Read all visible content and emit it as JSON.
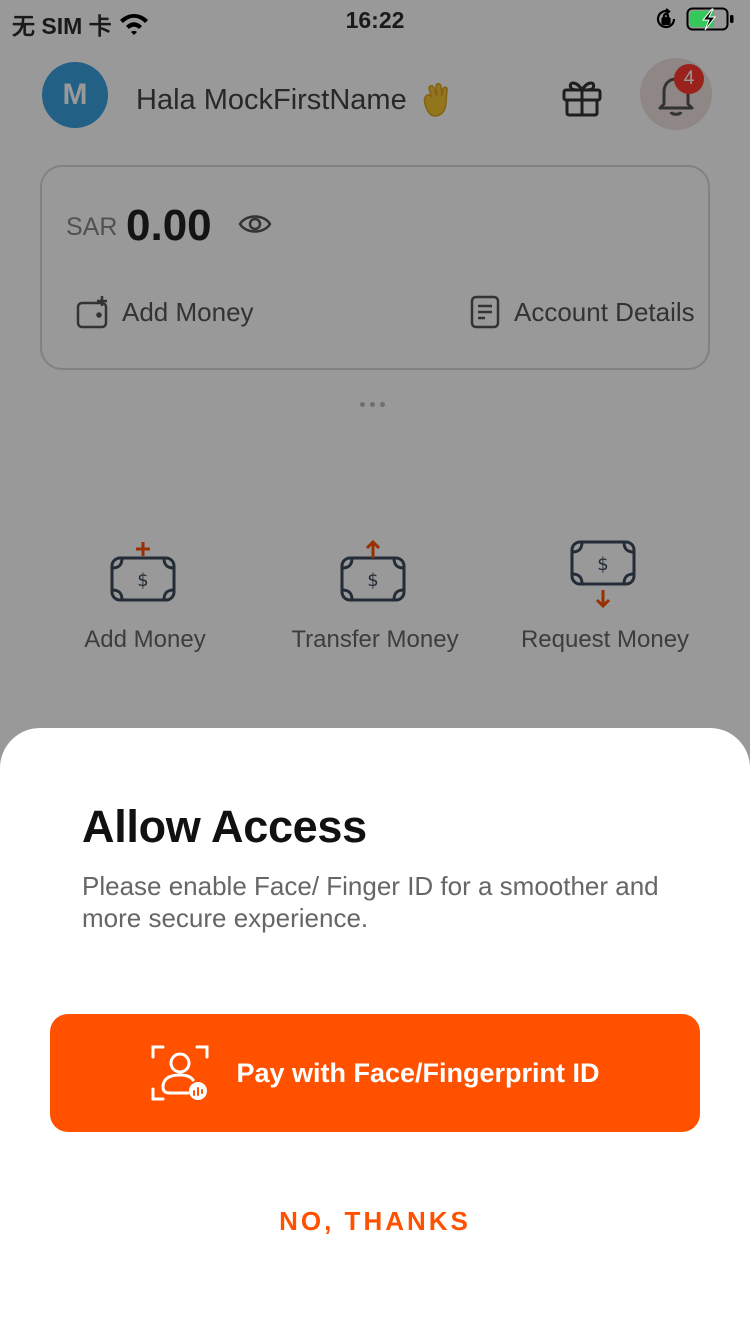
{
  "status_bar": {
    "carrier": "无 SIM 卡",
    "time": "16:22",
    "wifi_icon": "wifi-icon",
    "orientation_icon": "orientation-lock-icon",
    "battery_icon": "battery-charging-icon"
  },
  "home": {
    "avatar_initial": "M",
    "greeting": "Hala MockFirstName",
    "wave_icon": "waving-hand-icon",
    "gift_icon": "gift-icon",
    "bell_icon": "bell-icon",
    "notification_count": "4",
    "balance": {
      "currency": "SAR",
      "amount": "0.00",
      "eye_icon": "eye-icon"
    },
    "card_actions": {
      "add_money": "Add Money",
      "account_details": "Account Details"
    },
    "quick_actions": [
      {
        "label": "Add Money",
        "icon": "add-money-icon"
      },
      {
        "label": "Transfer Money",
        "icon": "transfer-money-icon"
      },
      {
        "label": "Request Money",
        "icon": "request-money-icon"
      }
    ]
  },
  "sheet": {
    "title": "Allow Access",
    "description": "Please enable Face/ Finger ID for a smoother and more secure experience.",
    "primary_button": "Pay with Face/Fingerprint ID",
    "primary_icon": "face-id-icon",
    "secondary_button": "NO, THANKS"
  },
  "colors": {
    "accent": "#FF5100",
    "avatar": "#3AA0E0",
    "badge": "#FF3B30"
  }
}
